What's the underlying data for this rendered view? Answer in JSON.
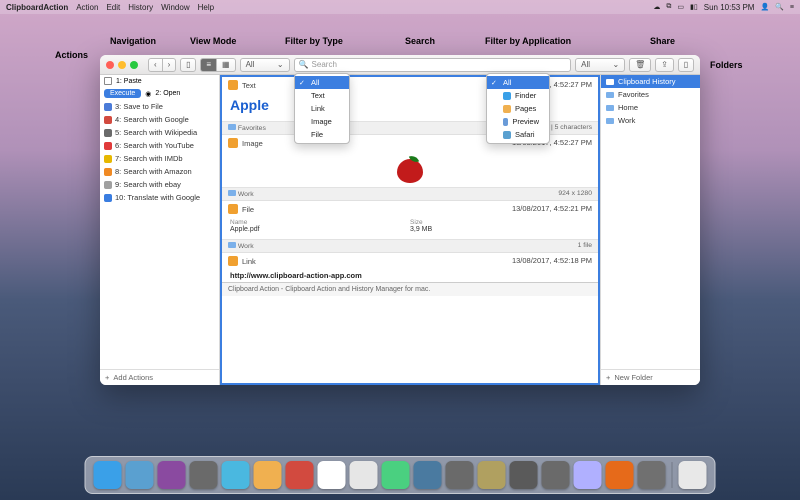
{
  "menubar": {
    "app": "ClipboardAction",
    "items": [
      "Action",
      "Edit",
      "History",
      "Window",
      "Help"
    ],
    "clock": "Sun 10:53 PM",
    "right_icons": [
      "cloud-icon",
      "wifi-icon",
      "display-icon",
      "battery-icon"
    ]
  },
  "callouts": {
    "actions": "Actions",
    "navigation": "Navigation",
    "view_mode": "View Mode",
    "filter_type": "Filter by Type",
    "search": "Search",
    "filter_app": "Filter by Application",
    "share": "Share",
    "folders": "Folders"
  },
  "toolbar": {
    "filter_type_value": "All",
    "search_placeholder": "Search",
    "filter_app_value": "All"
  },
  "dropdown_type": {
    "items": [
      "All",
      "Text",
      "Link",
      "Image",
      "File"
    ],
    "selected": "All"
  },
  "dropdown_app": {
    "items": [
      {
        "label": "All",
        "icon": ""
      },
      {
        "label": "Finder",
        "icon": "#3aa0e8"
      },
      {
        "label": "Pages",
        "icon": "#f0b050"
      },
      {
        "label": "Preview",
        "icon": "#6a9bd8"
      },
      {
        "label": "Safari",
        "icon": "#5aa0d0"
      }
    ],
    "selected": "All"
  },
  "actions_pane": {
    "row1_left": "1: Paste",
    "row1_right": "2: Open",
    "execute": "Execute",
    "radio": "◉",
    "items": [
      {
        "icon": "#4b7bd8",
        "label": "3: Save to File"
      },
      {
        "icon": "#d24a3f",
        "label": "4: Search with Google"
      },
      {
        "icon": "#6a6a6a",
        "label": "5: Search with Wikipedia"
      },
      {
        "icon": "#e03a3a",
        "label": "6: Search with YouTube"
      },
      {
        "icon": "#e6b800",
        "label": "7: Search with IMDb"
      },
      {
        "icon": "#f08a24",
        "label": "8: Search with Amazon"
      },
      {
        "icon": "#a0a0a0",
        "label": "9: Search with ebay"
      },
      {
        "icon": "#3a7de0",
        "label": "10: Translate with Google"
      }
    ],
    "footer": "Add Actions"
  },
  "center": {
    "text_card": {
      "type": "Text",
      "icon": "#f0a030",
      "timestamp": "13/08/2017, 4:52:27 PM",
      "content": "Apple",
      "folder": "Favorites",
      "stats": "1 line | 1 word | 5 characters"
    },
    "image_card": {
      "type": "Image",
      "icon": "#f0a030",
      "timestamp": "13/08/2017, 4:52:27 PM",
      "folder": "Work",
      "dims": "924 x 1280"
    },
    "file_card": {
      "type": "File",
      "icon": "#f0a030",
      "timestamp": "13/08/2017, 4:52:21 PM",
      "name_label": "Name",
      "name": "Apple.pdf",
      "size_label": "Size",
      "size": "3,9 MB",
      "folder": "Work",
      "stats": "1 file"
    },
    "link_card": {
      "type": "Link",
      "icon": "#f0a030",
      "timestamp": "13/08/2017, 4:52:18 PM",
      "url": "http://www.clipboard-action-app.com"
    }
  },
  "statusbar": "Clipboard Action - Clipboard Action and History Manager for mac.",
  "folders_pane": {
    "items": [
      "Clipboard History",
      "Favorites",
      "Home",
      "Work"
    ],
    "selected": "Clipboard History",
    "footer": "New Folder"
  },
  "dock_colors": [
    "#3aa0e8",
    "#5aa0d0",
    "#8a4aa0",
    "#6a6a6a",
    "#4ab8e0",
    "#f0b050",
    "#d24a3f",
    "#fff",
    "#e6e6e6",
    "#4ad080",
    "#4a7aa0",
    "#6a6a6a",
    "#b0a060",
    "#5a5a5a",
    "#6a6a6a",
    "#b0b0ff",
    "#e66a1a",
    "#707070",
    "#e8e8e8"
  ]
}
